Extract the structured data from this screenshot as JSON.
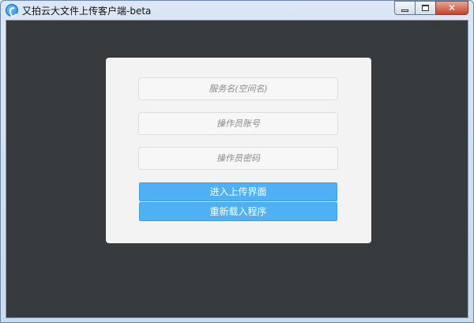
{
  "window": {
    "title": "又拍云大文件上传客户端-beta",
    "controls": {
      "minimize": "",
      "maximize": "",
      "close": "✕"
    }
  },
  "form": {
    "service_placeholder": "服务名(空间名)",
    "operator_account_placeholder": "操作员账号",
    "operator_password_placeholder": "操作员密码",
    "enter_upload_label": "进入上传界面",
    "reload_label": "重新载入程序"
  },
  "colors": {
    "background": "#383b3e",
    "panel": "#f3f3f3",
    "button": "#4fb0f3"
  },
  "icons": [
    "app-logo-icon",
    "minimize-icon",
    "maximize-icon",
    "close-icon"
  ]
}
